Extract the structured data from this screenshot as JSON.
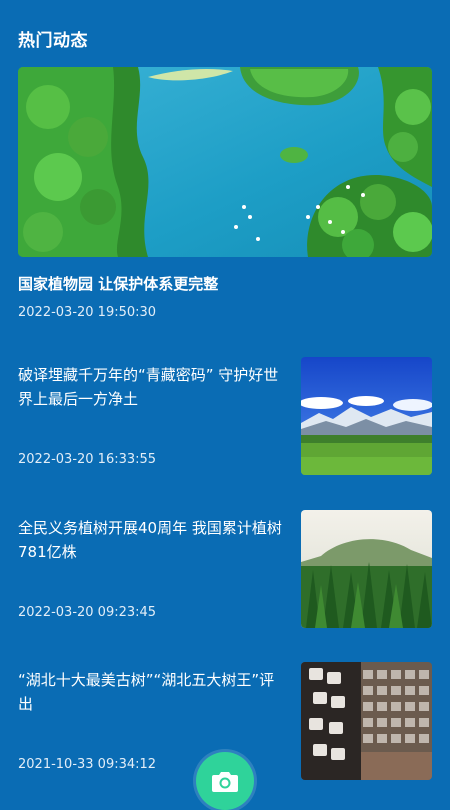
{
  "section": {
    "title": "热门动态"
  },
  "hero": {
    "image_icon": "lake-landscape-image",
    "title": "国家植物园 让保护体系更完整",
    "time": "2022-03-20 19:50:30"
  },
  "news": [
    {
      "title": "破译埋藏千万年的“青藏密码” 守护好世界上最后一方净土",
      "time": "2022-03-20 16:33:55",
      "image_icon": "plateau-grassland-image"
    },
    {
      "title": "全民义务植树开展40周年 我国累计植树781亿株",
      "time": "2022-03-20 09:23:45",
      "image_icon": "forest-image"
    },
    {
      "title": "“湖北十大最美古树”“湖北五大树王”评出",
      "time": "2021-10-33 09:34:12",
      "image_icon": "specimen-wall-image"
    }
  ],
  "fab": {
    "icon": "camera-icon"
  },
  "colors": {
    "background": "#0a6cb4",
    "fab": "#2fd39a"
  }
}
